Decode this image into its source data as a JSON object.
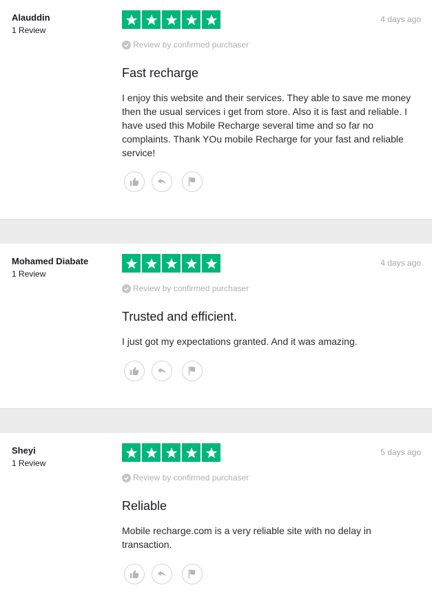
{
  "verified_label": "Review by confirmed purchaser",
  "colors": {
    "star_green": "#00b67a",
    "muted": "#a8a8a8"
  },
  "icons": [
    "star-icon",
    "check-circle-icon",
    "thumbs-up-icon",
    "reply-icon",
    "flag-icon"
  ],
  "reviews": [
    {
      "name": "Alauddin",
      "count": "1 Review",
      "rating": 5,
      "date": "4 days ago",
      "title": "Fast recharge",
      "body": "I enjoy this website and their services. They able to save me money then the usual services i get from store. Also it is fast and reliable. I have used this Mobile Recharge several time and so far no complaints. Thank YOu mobile Recharge for your fast and reliable service!"
    },
    {
      "name": "Mohamed Diabate",
      "count": "1 Review",
      "rating": 5,
      "date": "4 days ago",
      "title": "Trusted and efficient.",
      "body": "I just got my expectations granted. And it was amazing."
    },
    {
      "name": "Sheyi",
      "count": "1 Review",
      "rating": 5,
      "date": "5 days ago",
      "title": "Reliable",
      "body": "Mobile recharge.com is a very reliable site with no delay in transaction."
    }
  ]
}
